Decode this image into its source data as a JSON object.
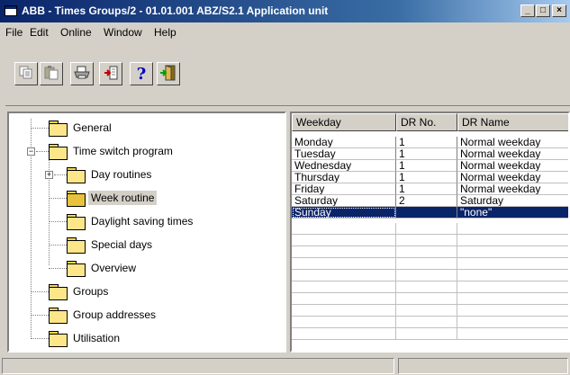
{
  "window": {
    "title": "ABB - Times Groups/2 - 01.01.001 ABZ/S2.1 Application unit",
    "minimize": "_",
    "maximize": "□",
    "close": "×"
  },
  "menu": {
    "file": "File",
    "edit": "Edit",
    "online": "Online",
    "window": "Window",
    "help": "Help"
  },
  "toolbar": {
    "copy_icon": "copy-icon",
    "paste_icon": "paste-icon",
    "print_icon": "print-icon",
    "import_icon": "import-icon",
    "help_glyph": "?",
    "exit_icon": "exit-door-icon"
  },
  "tree": {
    "general": "General",
    "time_switch_program": "Time switch program",
    "day_routines": "Day routines",
    "week_routine": "Week routine",
    "daylight_saving_times": "Daylight saving times",
    "special_days": "Special days",
    "overview": "Overview",
    "groups": "Groups",
    "group_addresses": "Group addresses",
    "utilisation": "Utilisation"
  },
  "grid": {
    "headers": [
      "Weekday",
      "DR No.",
      "DR Name"
    ],
    "rows": [
      [
        "Monday",
        "1",
        "Normal weekday"
      ],
      [
        "Tuesday",
        "1",
        "Normal weekday"
      ],
      [
        "Wednesday",
        "1",
        "Normal weekday"
      ],
      [
        "Thursday",
        "1",
        "Normal weekday"
      ],
      [
        "Friday",
        "1",
        "Normal weekday"
      ],
      [
        "Saturday",
        "2",
        "Saturday"
      ],
      [
        "Sunday",
        "",
        "\"none\""
      ]
    ],
    "selected_row": 6
  },
  "colors": {
    "selection": "#0a246a",
    "face": "#d4d0c8",
    "folder": "#fde68a"
  }
}
